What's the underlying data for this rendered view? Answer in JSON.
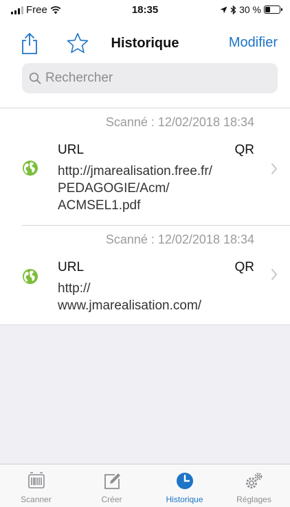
{
  "status_bar": {
    "carrier": "Free",
    "time": "18:35",
    "battery": "30 %",
    "battery_level": 0.3
  },
  "nav": {
    "title": "Historique",
    "edit_label": "Modifier",
    "share_icon": "share-icon",
    "favorite_icon": "star-icon"
  },
  "search": {
    "placeholder": "Rechercher"
  },
  "history": [
    {
      "date": "Scanné : 12/02/2018 18:34",
      "type": "URL",
      "format": "QR",
      "url_lines": [
        "http://jmarealisation.free.fr/",
        "PEDAGOGIE/Acm/",
        "ACMSEL1.pdf"
      ],
      "icon": "globe-icon"
    },
    {
      "date": "Scanné : 12/02/2018 18:34",
      "type": "URL",
      "format": "QR",
      "url_lines": [
        "http://",
        "www.jmarealisation.com/"
      ],
      "icon": "globe-icon"
    }
  ],
  "tabs": [
    {
      "label": "Scanner",
      "icon": "barcode-scanner-icon",
      "active": false
    },
    {
      "label": "Créer",
      "icon": "edit-icon",
      "active": false
    },
    {
      "label": "Historique",
      "icon": "clock-icon",
      "active": true
    },
    {
      "label": "Réglages",
      "icon": "gears-icon",
      "active": false
    }
  ],
  "colors": {
    "accent": "#1e74c6",
    "globe": "#7cbe3a",
    "secondary_text": "#9b9b9f",
    "empty_background": "#efeff4"
  }
}
